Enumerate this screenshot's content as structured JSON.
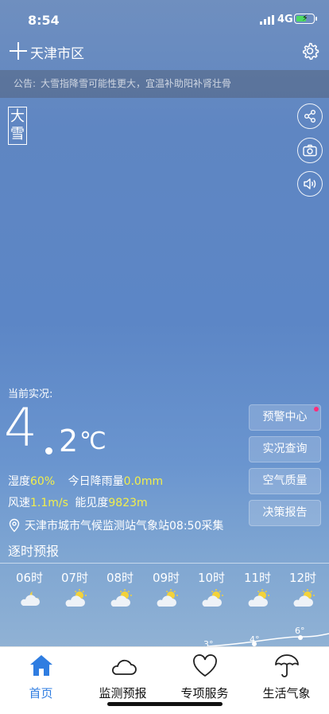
{
  "status_bar": {
    "time": "8:54",
    "network": "4G"
  },
  "header": {
    "city": "天津市区"
  },
  "notice": {
    "label": "公告:",
    "text": "大雪指降雪可能性更大，宜温补助阳补肾壮骨"
  },
  "weather_stamp": {
    "line1": "大",
    "line2": "雪"
  },
  "current": {
    "label": "当前实况:",
    "temp_int": "4",
    "temp_dec": "2",
    "temp_unit": "℃",
    "humidity_label": "湿度",
    "humidity_value": "60%",
    "rain_label": "今日降雨量",
    "rain_value": "0.0mm",
    "wind_label": "风速",
    "wind_value": "1.1m/s",
    "visibility_label": "能见度",
    "visibility_value": "9823m",
    "station": "天津市城市气候监测站气象站08:50采集"
  },
  "actions": [
    "预警中心",
    "实况查询",
    "空气质量",
    "决策报告"
  ],
  "hourly": {
    "title": "逐时预报",
    "hours": [
      "06时",
      "07时",
      "08时",
      "09时",
      "10时",
      "11时",
      "12时"
    ],
    "icons": [
      "moon-cloud-icon",
      "sun-cloud-icon",
      "sun-cloud-icon",
      "sun-cloud-icon",
      "sun-cloud-icon",
      "sun-cloud-icon",
      "sun-cloud-icon"
    ],
    "temps": [
      "3°",
      "4°",
      "6°"
    ]
  },
  "tabs": [
    "首页",
    "监测预报",
    "专项服务",
    "生活气象"
  ],
  "colors": {
    "accent": "#2f7de1",
    "highlight": "#f3ef4a",
    "alert_dot": "#ff2d7a"
  }
}
